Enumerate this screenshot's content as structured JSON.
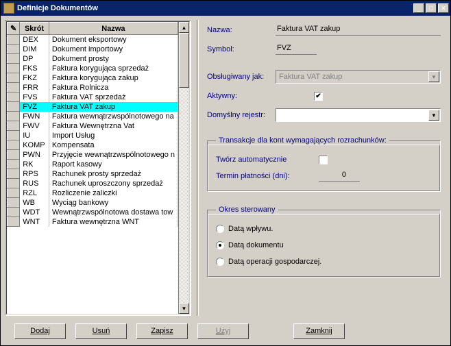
{
  "window": {
    "title": "Definicje Dokumentów"
  },
  "grid": {
    "headers": {
      "skrot": "Skrót",
      "nazwa": "Nazwa"
    },
    "rows": [
      {
        "s": "DEX",
        "n": "Dokument eksportowy"
      },
      {
        "s": "DIM",
        "n": "Dokument importowy"
      },
      {
        "s": "DP",
        "n": "Dokument prosty"
      },
      {
        "s": "FKS",
        "n": "Faktura korygująca sprzedaż"
      },
      {
        "s": "FKZ",
        "n": "Faktura korygująca zakup"
      },
      {
        "s": "FRR",
        "n": "Faktura Rolnicza"
      },
      {
        "s": "FVS",
        "n": "Faktura VAT sprzedaż"
      },
      {
        "s": "FVZ",
        "n": "Faktura VAT zakup"
      },
      {
        "s": "FWN",
        "n": "Faktura wewnątrzwspólnotowego na"
      },
      {
        "s": "FWV",
        "n": "Faktura Wewnętrzna Vat"
      },
      {
        "s": "IU",
        "n": "Import Usług"
      },
      {
        "s": "KOMP",
        "n": "Kompensata"
      },
      {
        "s": "PWN",
        "n": "Przyjęcie wewnątrzwspólnotowego n"
      },
      {
        "s": "RK",
        "n": "Raport kasowy"
      },
      {
        "s": "RPS",
        "n": "Rachunek prosty sprzedaż"
      },
      {
        "s": "RUS",
        "n": "Rachunek uproszczony sprzedaż"
      },
      {
        "s": "RZL",
        "n": "Rozliczenie zaliczki"
      },
      {
        "s": "WB",
        "n": "Wyciąg bankowy"
      },
      {
        "s": "WDT",
        "n": "Wewnątrzwspólnotowa dostawa tow"
      },
      {
        "s": "WNT",
        "n": "Faktura wewnętrzna WNT"
      }
    ],
    "selected": 7
  },
  "form": {
    "nazwa_label": "Nazwa:",
    "nazwa_value": "Faktura VAT zakup",
    "symbol_label": "Symbol:",
    "symbol_value": "FVZ",
    "obsluga_label": "Obsługiwany jak:",
    "obsluga_value": "Faktura VAT zakup",
    "aktywny_label": "Aktywny:",
    "rejestr_label": "Domyślny rejestr:"
  },
  "trans": {
    "legend": "Transakcje dla kont wymagających rozrachunków:",
    "tworz": "Twórz automatycznie",
    "termin": "Termin płatności (dni):",
    "termin_val": "0"
  },
  "okres": {
    "legend": "Okres sterowany",
    "r1": "Datą wpływu.",
    "r2": "Datą dokumentu",
    "r3": "Datą operacji gospodarczej."
  },
  "buttons": {
    "dodaj": "Dodaj",
    "usun": "Usuń",
    "zapisz": "Zapisz",
    "uzyj": "Użyj",
    "zamknij": "Zamknij"
  }
}
